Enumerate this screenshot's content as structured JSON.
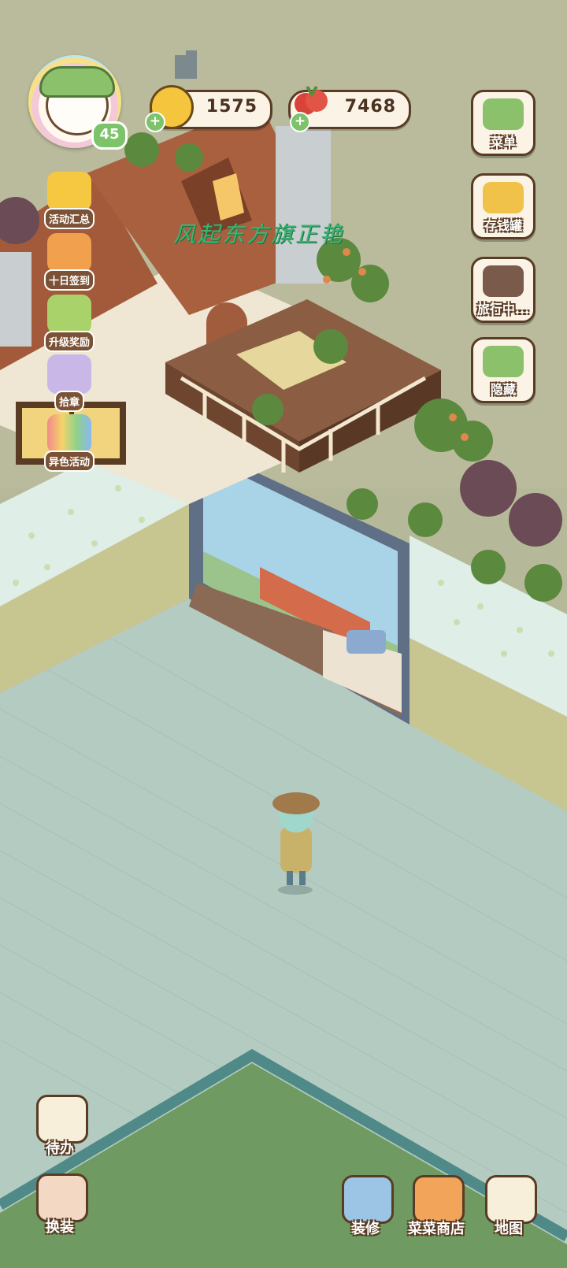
{
  "player": {
    "level": "45"
  },
  "currencies": {
    "coins": "1575",
    "produce": "7468"
  },
  "banner_text": "风起东方旗正艳",
  "left_menu": [
    {
      "label": "活动汇总",
      "icon": "crown-icon"
    },
    {
      "label": "十日签到",
      "icon": "gift-box-icon"
    },
    {
      "label": "升级奖励",
      "icon": "level-up-arrow-icon"
    },
    {
      "label": "拾章",
      "icon": "stamp-book-icon"
    },
    {
      "label": "异色活动",
      "icon": "rainbow-icon"
    }
  ],
  "right_menu": [
    {
      "label": "菜单",
      "icon": "menu-list-icon"
    },
    {
      "label": "存钱罐",
      "icon": "piggy-bank-icon"
    },
    {
      "label": "旅行中...",
      "icon": "camera-icon"
    },
    {
      "label": "隐藏",
      "icon": "hide-frame-icon"
    }
  ],
  "bottom_left": [
    {
      "label": "待办",
      "icon": "todo-checklist-icon"
    },
    {
      "label": "换装",
      "icon": "wardrobe-icon"
    }
  ],
  "bottom_right": [
    {
      "label": "装修",
      "icon": "decorate-trowel-icon"
    },
    {
      "label": "菜菜商店",
      "icon": "shop-stall-icon"
    },
    {
      "label": "地图",
      "icon": "map-icon"
    }
  ],
  "colors": {
    "floor": "#b4cbc2",
    "wall_wallpaper": "#dfeee6",
    "wainscot": "#c8c690",
    "roof": "#a25a3a",
    "hud_border": "#5a3b24",
    "accent_green": "#7cc36a",
    "banner_text": "#3bb573"
  }
}
